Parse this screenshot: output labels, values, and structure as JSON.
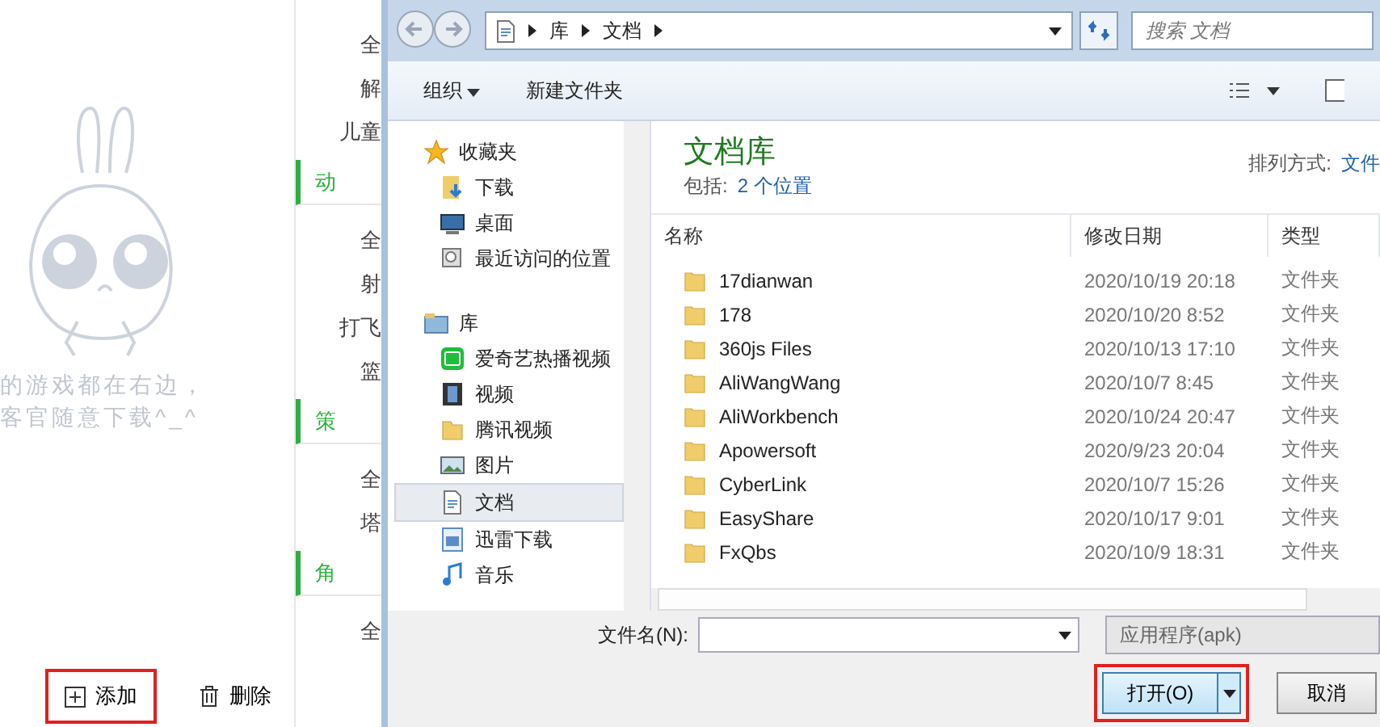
{
  "app": {
    "empty_message": [
      "的游戏都在右边，",
      "客官随意下载^_^"
    ],
    "categories": [
      {
        "kind": "item",
        "label": "全"
      },
      {
        "kind": "item",
        "label": "解"
      },
      {
        "kind": "item",
        "label": "儿童"
      },
      {
        "kind": "header",
        "label": "动"
      },
      {
        "kind": "item",
        "label": "全"
      },
      {
        "kind": "item",
        "label": "射"
      },
      {
        "kind": "item",
        "label": "打飞"
      },
      {
        "kind": "item",
        "label": "篮"
      },
      {
        "kind": "header",
        "label": "策"
      },
      {
        "kind": "item",
        "label": "全"
      },
      {
        "kind": "item",
        "label": "塔"
      },
      {
        "kind": "header",
        "label": "角"
      },
      {
        "kind": "item",
        "label": "全"
      }
    ],
    "buttons": [
      {
        "kind": "add",
        "label": "添加",
        "highlighted": true
      },
      {
        "kind": "delete",
        "label": "删除",
        "highlighted": false
      }
    ]
  },
  "dialog": {
    "breadcrumb": [
      "库",
      "文档"
    ],
    "search": {
      "placeholder": "搜索 文档"
    },
    "toolbar": {
      "organize": "组织",
      "new_folder": "新建文件夹"
    },
    "nav": [
      {
        "kind": "favorites",
        "label": "收藏夹",
        "selected": false,
        "children": [
          {
            "kind": "download",
            "label": "下载",
            "selected": false
          },
          {
            "kind": "desktop",
            "label": "桌面",
            "selected": false
          },
          {
            "kind": "recent",
            "label": "最近访问的位置",
            "selected": false
          }
        ]
      },
      {
        "kind": "library",
        "label": "库",
        "selected": false,
        "children": [
          {
            "kind": "app",
            "label": "爱奇艺热播视频",
            "selected": false
          },
          {
            "kind": "video",
            "label": "视频",
            "selected": false
          },
          {
            "kind": "folder",
            "label": "腾讯视频",
            "selected": false
          },
          {
            "kind": "pictures",
            "label": "图片",
            "selected": false
          },
          {
            "kind": "documents",
            "label": "文档",
            "selected": true
          },
          {
            "kind": "app-download",
            "label": "迅雷下载",
            "selected": false
          },
          {
            "kind": "music",
            "label": "音乐",
            "selected": false
          }
        ]
      }
    ],
    "library": {
      "title": "文档库",
      "includes_label": "包括:",
      "includes_link": "2 个位置",
      "arrange_label": "排列方式:",
      "arrange_value": "文件"
    },
    "columns": [
      "名称",
      "修改日期",
      "类型"
    ],
    "rows": [
      {
        "name": "17dianwan",
        "date": "2020/10/19 20:18",
        "type": "文件夹"
      },
      {
        "name": "178",
        "date": "2020/10/20 8:52",
        "type": "文件夹"
      },
      {
        "name": "360js Files",
        "date": "2020/10/13 17:10",
        "type": "文件夹"
      },
      {
        "name": "AliWangWang",
        "date": "2020/10/7 8:45",
        "type": "文件夹"
      },
      {
        "name": "AliWorkbench",
        "date": "2020/10/24 20:47",
        "type": "文件夹"
      },
      {
        "name": "Apowersoft",
        "date": "2020/9/23 20:04",
        "type": "文件夹"
      },
      {
        "name": "CyberLink",
        "date": "2020/10/7 15:26",
        "type": "文件夹"
      },
      {
        "name": "EasyShare",
        "date": "2020/10/17 9:01",
        "type": "文件夹"
      },
      {
        "name": "FxQbs",
        "date": "2020/10/9 18:31",
        "type": "文件夹"
      }
    ],
    "filename_label": "文件名(N):",
    "filter": "应用程序(apk)",
    "open_button": {
      "label": "打开(O)",
      "highlighted": true
    },
    "cancel_button": {
      "label": "取消",
      "highlighted": false
    }
  }
}
